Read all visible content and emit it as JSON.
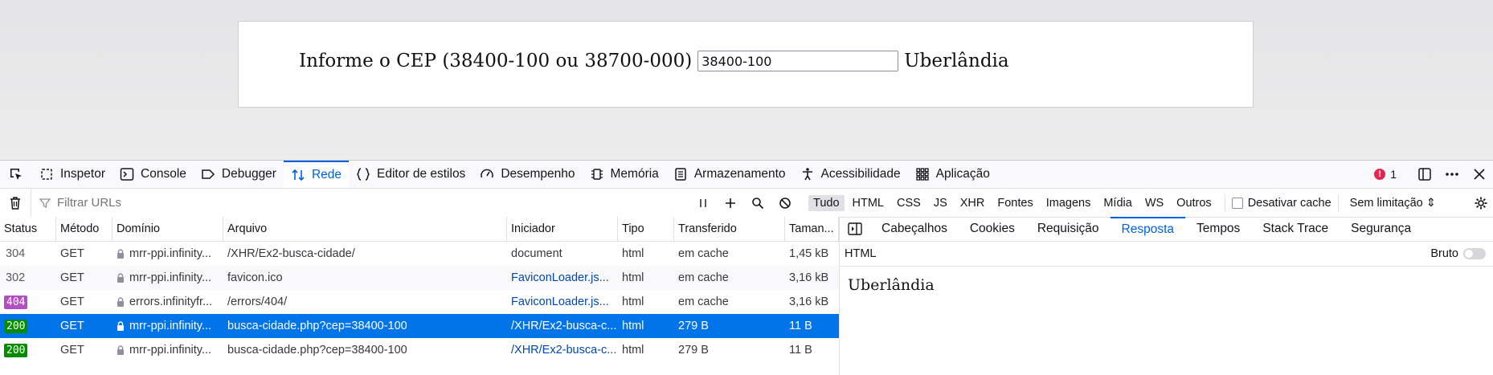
{
  "page": {
    "label": "Informe o CEP (38400-100 ou 38700-000)",
    "cep_value": "38400-100",
    "result": "Uberlândia"
  },
  "devtools": {
    "tools": [
      {
        "label": "Inspetor",
        "icon": "inspector-icon"
      },
      {
        "label": "Console",
        "icon": "console-icon"
      },
      {
        "label": "Debugger",
        "icon": "debugger-icon"
      },
      {
        "label": "Rede",
        "icon": "network-icon"
      },
      {
        "label": "Editor de estilos",
        "icon": "style-editor-icon"
      },
      {
        "label": "Desempenho",
        "icon": "performance-icon"
      },
      {
        "label": "Memória",
        "icon": "memory-icon"
      },
      {
        "label": "Armazenamento",
        "icon": "storage-icon"
      },
      {
        "label": "Acessibilidade",
        "icon": "accessibility-icon"
      },
      {
        "label": "Aplicação",
        "icon": "application-icon"
      }
    ],
    "active_tool": "Rede",
    "error_count": "1",
    "filter_placeholder": "Filtrar URLs",
    "types": [
      "Tudo",
      "HTML",
      "CSS",
      "JS",
      "XHR",
      "Fontes",
      "Imagens",
      "Mídia",
      "WS",
      "Outros"
    ],
    "selected_type": "Tudo",
    "disable_cache": "Desativar cache",
    "throttle": "Sem limitação ⇕",
    "columns": [
      "Status",
      "Método",
      "Domínio",
      "Arquivo",
      "Iniciador",
      "Tipo",
      "Transferido",
      "Taman..."
    ],
    "rows": [
      {
        "status": "304",
        "method": "GET",
        "domain": "mrr-ppi.infinity...",
        "file": "/XHR/Ex2-busca-cidade/",
        "initiator": "document",
        "type": "html",
        "transferred": "em cache",
        "size": "1,45 kB"
      },
      {
        "status": "302",
        "method": "GET",
        "domain": "mrr-ppi.infinity...",
        "file": "favicon.ico",
        "initiator": "FaviconLoader.js...",
        "type": "html",
        "transferred": "em cache",
        "size": "3,16 kB"
      },
      {
        "status": "404",
        "method": "GET",
        "domain": "errors.infinityfr...",
        "file": "/errors/404/",
        "initiator": "FaviconLoader.js...",
        "type": "html",
        "transferred": "em cache",
        "size": "3,16 kB"
      },
      {
        "status": "200",
        "method": "GET",
        "domain": "mrr-ppi.infinity...",
        "file": "busca-cidade.php?cep=38400-100",
        "initiator": "/XHR/Ex2-busca-c...",
        "type": "html",
        "transferred": "279 B",
        "size": "11 B"
      },
      {
        "status": "200",
        "method": "GET",
        "domain": "mrr-ppi.infinity...",
        "file": "busca-cidade.php?cep=38400-100",
        "initiator": "/XHR/Ex2-busca-c...",
        "type": "html",
        "transferred": "279 B",
        "size": "11 B"
      }
    ],
    "selected_row": 3,
    "panel_tabs": [
      "Cabeçalhos",
      "Cookies",
      "Requisição",
      "Resposta",
      "Tempos",
      "Stack Trace",
      "Segurança"
    ],
    "active_panel_tab": "Resposta",
    "response_format": "HTML",
    "raw_label": "Bruto",
    "response_body": "Uberlândia"
  },
  "colors": {
    "accent": "#0061e0",
    "selected_row": "#0074e8",
    "status_200": "#058b00",
    "status_404": "#b44ec5",
    "error": "#e22850"
  }
}
